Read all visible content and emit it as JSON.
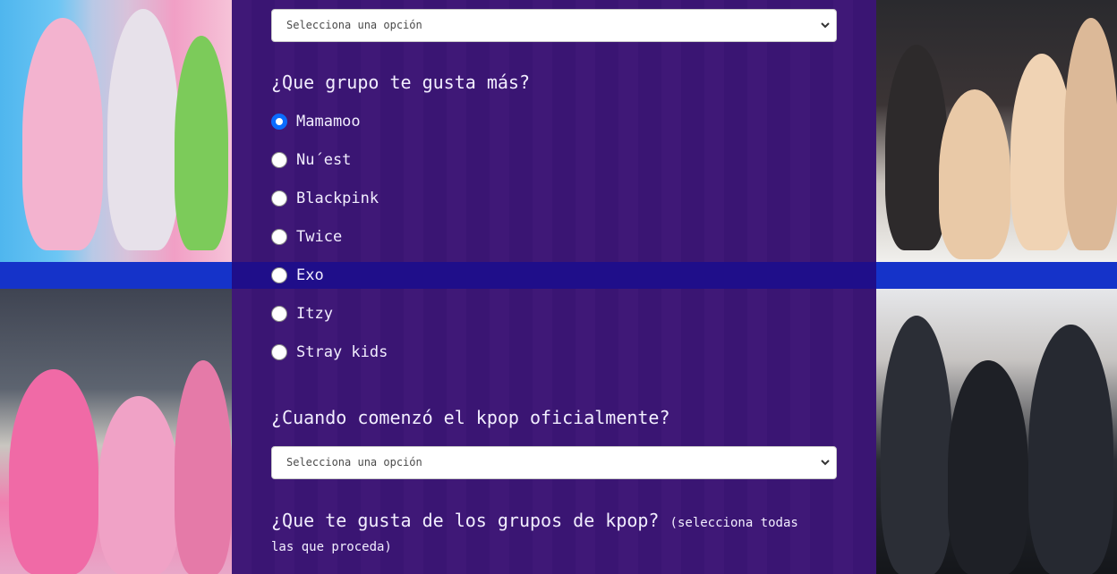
{
  "select_top": {
    "placeholder": "Selecciona una opción"
  },
  "q_group": {
    "title": "¿Que grupo te gusta más?",
    "options": [
      "Mamamoo",
      "Nu´est",
      "Blackpink",
      "Twice",
      "Exo",
      "Itzy",
      "Stray kids"
    ],
    "selected_index": 0
  },
  "q_start": {
    "title": "¿Cuando comenzó el kpop oficialmente?",
    "placeholder": "Selecciona una opción"
  },
  "q_like": {
    "title": "¿Que te gusta de los grupos de kpop?",
    "hint_part1": "(selecciona todas",
    "hint_part2": "las que proceda)"
  },
  "icons": {
    "select_arrow": "chevron-down-icon"
  },
  "colors": {
    "panel": "#3a1670",
    "band": "#1533c9",
    "radio_checked": "#0b6cff"
  }
}
